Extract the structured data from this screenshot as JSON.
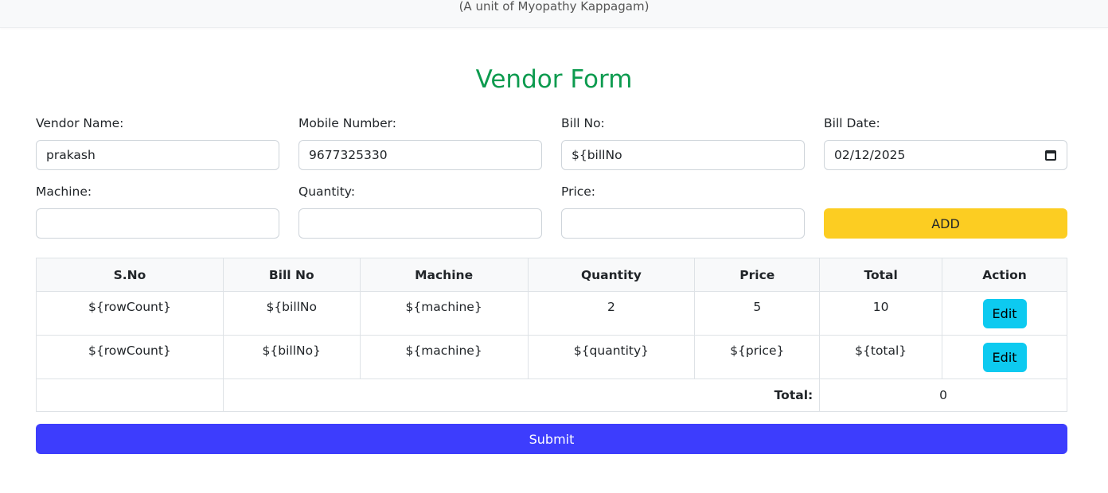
{
  "header": {
    "subtitle": "(A unit of Myopathy Kappagam)"
  },
  "form": {
    "title": "Vendor Form",
    "fields": {
      "vendor_name": {
        "label": "Vendor Name:",
        "value": "prakash"
      },
      "mobile_number": {
        "label": "Mobile Number:",
        "value": "9677325330"
      },
      "bill_no": {
        "label": "Bill No:",
        "value": "${billNo"
      },
      "bill_date": {
        "label": "Bill Date:",
        "value": "02/12/2025",
        "icon": "calendar-icon"
      },
      "machine": {
        "label": "Machine:",
        "value": ""
      },
      "quantity": {
        "label": "Quantity:",
        "value": ""
      },
      "price": {
        "label": "Price:",
        "value": ""
      }
    },
    "add_label": "ADD",
    "submit_label": "Submit"
  },
  "table": {
    "headers": [
      "S.No",
      "Bill No",
      "Machine",
      "Quantity",
      "Price",
      "Total",
      "Action"
    ],
    "rows": [
      {
        "sno": "${rowCount}",
        "bill_no": "${billNo",
        "machine": "${machine}",
        "quantity": "2",
        "price": "5",
        "total": "10",
        "action": "Edit"
      },
      {
        "sno": "${rowCount}",
        "bill_no": "${billNo}",
        "machine": "${machine}",
        "quantity": "${quantity}",
        "price": "${price}",
        "total": "${total}",
        "action": "Edit"
      }
    ],
    "total_label": "Total:",
    "total_value": "0"
  },
  "colors": {
    "title": "#0d9b4f",
    "add_button": "#fccd22",
    "edit_button": "#0dcaf0",
    "submit_button": "#3d3dfd"
  }
}
